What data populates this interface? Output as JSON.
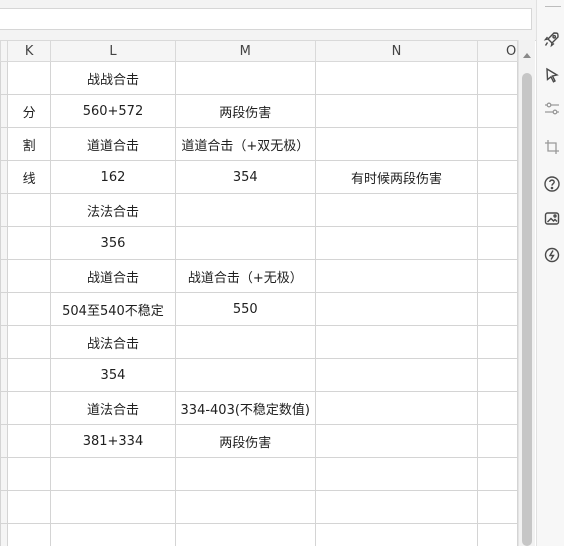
{
  "sheet": {
    "columns": [
      "K",
      "L",
      "M",
      "N",
      "O"
    ],
    "rows": [
      [
        "",
        "战战合击",
        "",
        ""
      ],
      [
        "分",
        "560+572",
        "两段伤害",
        ""
      ],
      [
        "割",
        "道道合击",
        "道道合击（+双无极）",
        ""
      ],
      [
        "线",
        "162",
        "354",
        "有时候两段伤害"
      ],
      [
        "",
        "法法合击",
        "",
        ""
      ],
      [
        "",
        "356",
        "",
        ""
      ],
      [
        "",
        "战道合击",
        "战道合击（+无极）",
        ""
      ],
      [
        "",
        "504至540不稳定",
        "550",
        ""
      ],
      [
        "",
        "战法合击",
        "",
        ""
      ],
      [
        "",
        "354",
        "",
        ""
      ],
      [
        "",
        "道法合击",
        "334-403(不稳定数值)",
        ""
      ],
      [
        "",
        "381+334",
        "两段伤害",
        ""
      ],
      [
        "",
        "",
        "",
        ""
      ],
      [
        "",
        "",
        "",
        ""
      ],
      [
        "",
        "",
        "",
        ""
      ]
    ]
  },
  "sidebar": {
    "icons": [
      "rocket-icon",
      "pointer-icon",
      "sliders-icon",
      "crop-icon",
      "help-icon",
      "gallery-icon",
      "power-icon"
    ]
  }
}
